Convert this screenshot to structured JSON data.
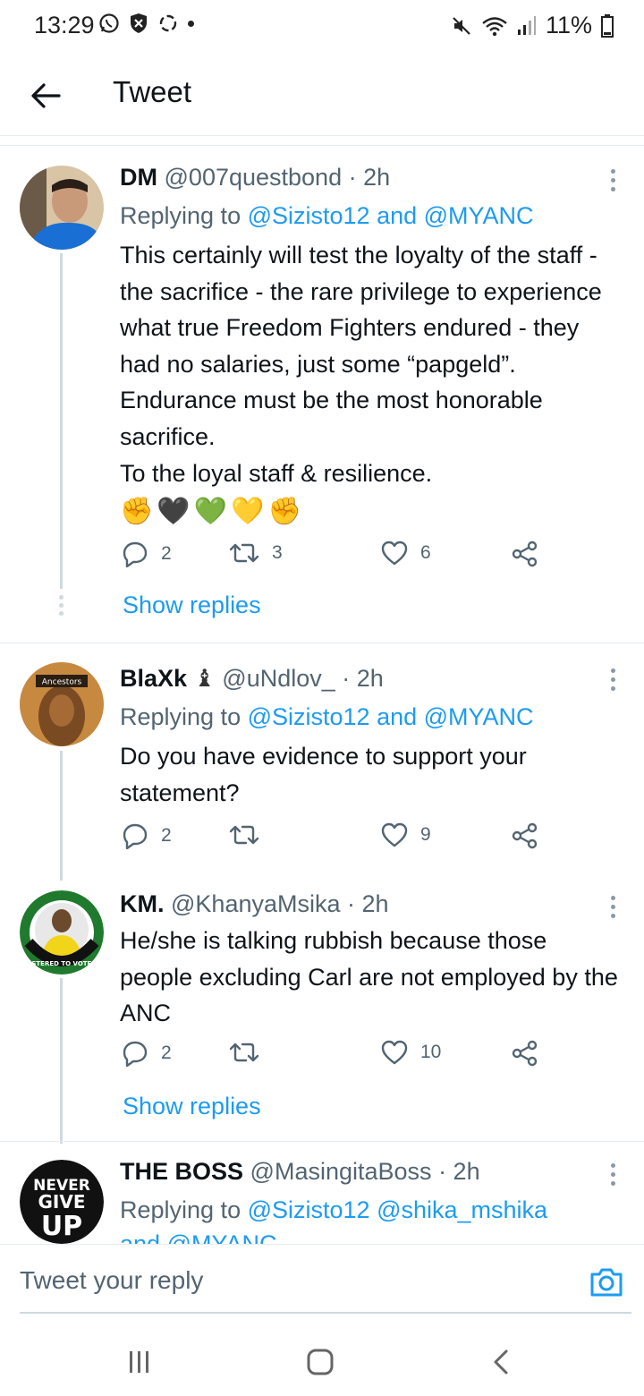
{
  "status_bar": {
    "time": "13:29",
    "battery": "11%"
  },
  "header": {
    "title": "Tweet"
  },
  "tweets": [
    {
      "name": "DM",
      "handle": "@007questbond",
      "time": "· 2h",
      "replying_prefix": "Replying to",
      "replying_targets": "@Sizisto12 and @MYANC",
      "text": "This certainly will test the loyalty of the staff - the sacrifice - the rare privilege to experience what true Freedom Fighters endured - they had no salaries, just some “papgeld”. Endurance must be the most honorable sacrifice.\nTo the loyal staff & resilience.",
      "emoji": [
        "✊",
        "🖤",
        "💚",
        "💛",
        "✊"
      ],
      "replies": "2",
      "retweets": "3",
      "likes": "6",
      "show_replies": "Show replies"
    },
    {
      "name": "BlaXk",
      "name_emoji": "♝",
      "handle": "@uNdlov_",
      "time": "· 2h",
      "avatar_label": "Ancestors",
      "replying_prefix": "Replying to",
      "replying_targets": "@Sizisto12 and @MYANC",
      "text": "Do you have evidence to support your statement?",
      "replies": "2",
      "retweets": "",
      "likes": "9"
    },
    {
      "name": "KM.",
      "handle": "@KhanyaMsika",
      "time": "· 2h",
      "avatar_label": "REGISTERED TO VOTE ANC",
      "text": "He/she is talking rubbish because those people excluding Carl are not employed by the ANC",
      "replies": "2",
      "retweets": "",
      "likes": "10",
      "show_replies": "Show replies"
    },
    {
      "name": "THE BOSS",
      "handle": "@MasingitaBoss",
      "time": "· 2h",
      "avatar_label_1": "NEVER",
      "avatar_label_2": "GIVE",
      "avatar_label_3": "UP",
      "replying_prefix": "Replying to",
      "replying_targets": "@Sizisto12 @shika_mshika",
      "replying_more": "and @MYANC"
    }
  ],
  "composer": {
    "placeholder": "Tweet your reply"
  },
  "icons": {
    "back": "arrow-left-icon",
    "reply": "reply-icon",
    "retweet": "retweet-icon",
    "like": "heart-icon",
    "share": "share-icon",
    "more": "more-vertical-icon",
    "camera": "camera-icon"
  },
  "colors": {
    "accent": "#1d9bf0",
    "muted": "#536471",
    "text": "#0f1419"
  }
}
